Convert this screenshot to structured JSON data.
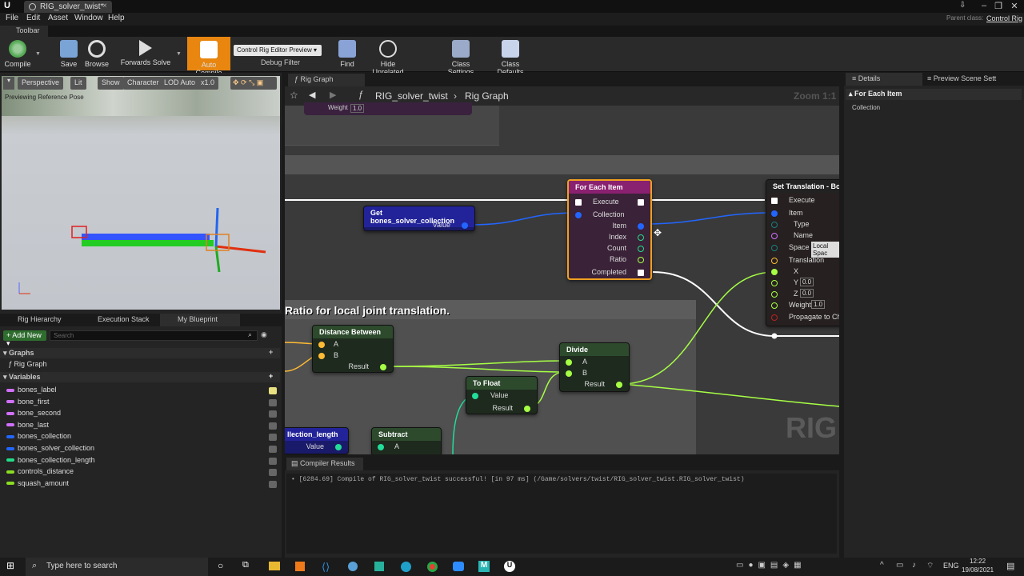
{
  "window": {
    "doc_tab": "RIG_solver_twist*",
    "parent_label": "Parent class:",
    "parent_value": "Control Rig"
  },
  "menu": [
    "File",
    "Edit",
    "Asset",
    "Window",
    "Help"
  ],
  "toolbar_tab": "Toolbar",
  "toolbar": {
    "compile": "Compile",
    "save": "Save",
    "browse": "Browse",
    "forwards_solve": "Forwards Solve",
    "auto_compile": "Auto Compile",
    "preview_select": "Control Rig Editor Preview",
    "debug_filter": "Debug Filter",
    "find": "Find",
    "hide_unrelated": "Hide Unrelated",
    "class_settings": "Class Settings",
    "class_defaults": "Class Defaults"
  },
  "viewport": {
    "perspective": "Perspective",
    "lit": "Lit",
    "show": "Show",
    "character": "Character",
    "lod": "LOD Auto",
    "speed": "x1.0",
    "info": "Previewing Reference Pose"
  },
  "left_tabs": [
    "Rig Hierarchy",
    "Execution Stack",
    "My Blueprint"
  ],
  "my_blueprint": {
    "add_new": "Add New",
    "search_placeholder": "Search",
    "graphs_header": "Graphs",
    "graph_item": "Rig Graph",
    "variables_header": "Variables",
    "variables": [
      {
        "name": "bones_label",
        "color": "#d070ff"
      },
      {
        "name": "bone_first",
        "color": "#d070ff"
      },
      {
        "name": "bone_second",
        "color": "#d070ff"
      },
      {
        "name": "bone_last",
        "color": "#d070ff"
      },
      {
        "name": "bones_collection",
        "color": "#2266ff"
      },
      {
        "name": "bones_solver_collection",
        "color": "#2266ff"
      },
      {
        "name": "bones_collection_length",
        "color": "#22dd88"
      },
      {
        "name": "controls_distance",
        "color": "#8cdd22"
      },
      {
        "name": "squash_amount",
        "color": "#8cdd22"
      }
    ]
  },
  "graph": {
    "tab": "Rig Graph",
    "breadcrumb_root": "RIG_solver_twist",
    "breadcrumb_leaf": "Rig Graph",
    "zoom": "Zoom 1:1",
    "watermark": "RIG",
    "comment": "Ratio for local joint translation.",
    "ghost_pin": "Weight",
    "ghost_val": "1.0",
    "nodes": {
      "get_bones": {
        "title": "Get bones_solver_collection",
        "value": "Value"
      },
      "for_each": {
        "title": "For Each Item",
        "execute": "Execute",
        "collection": "Collection",
        "item": "Item",
        "index": "Index",
        "count": "Count",
        "ratio": "Ratio",
        "completed": "Completed"
      },
      "set_translation": {
        "title": "Set Translation - Bone",
        "execute": "Execute",
        "item": "Item",
        "type": "Type",
        "name": "Name",
        "space": "Space",
        "space_val": "Local Spac",
        "translation": "Translation",
        "x": "X",
        "y": "Y",
        "y_val": "0.0",
        "z": "Z",
        "z_val": "0.0",
        "weight": "Weight",
        "weight_val": "1.0",
        "propagate": "Propagate to Chil"
      },
      "distance": {
        "title": "Distance Between",
        "a": "A",
        "b": "B",
        "result": "Result"
      },
      "divide": {
        "title": "Divide",
        "a": "A",
        "b": "B",
        "result": "Result"
      },
      "to_float": {
        "title": "To Float",
        "value": "Value",
        "result": "Result"
      },
      "collection_length": {
        "title": "llection_length",
        "value": "Value"
      },
      "subtract": {
        "title": "Subtract",
        "a": "A"
      }
    }
  },
  "details": {
    "tab": "Details",
    "tab2": "Preview Scene Sett",
    "header": "For Each Item",
    "row": "Collection"
  },
  "compiler": {
    "tab": "Compiler Results",
    "message": "[6284.69] Compile of RIG_solver_twist successful! [in 97 ms] (/Game/solvers/twist/RIG_solver_twist.RIG_solver_twist)"
  },
  "taskbar": {
    "search": "Type here to search",
    "lang": "ENG",
    "time": "12:22",
    "date": "19/08/2021"
  }
}
